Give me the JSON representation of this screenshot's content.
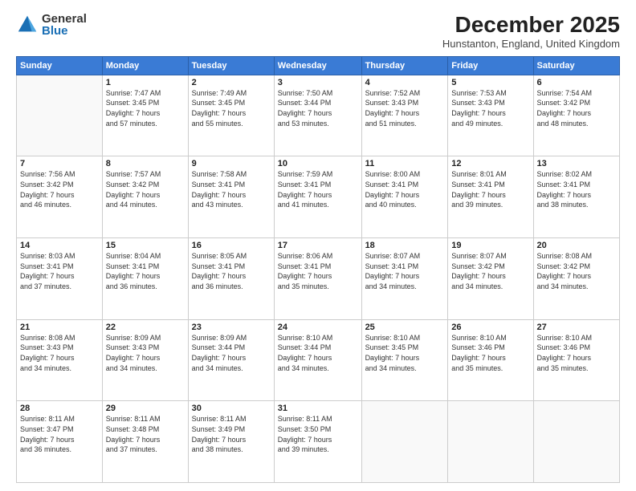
{
  "logo": {
    "general": "General",
    "blue": "Blue"
  },
  "title": "December 2025",
  "location": "Hunstanton, England, United Kingdom",
  "days_header": [
    "Sunday",
    "Monday",
    "Tuesday",
    "Wednesday",
    "Thursday",
    "Friday",
    "Saturday"
  ],
  "weeks": [
    [
      {
        "day": "",
        "info": ""
      },
      {
        "day": "1",
        "info": "Sunrise: 7:47 AM\nSunset: 3:45 PM\nDaylight: 7 hours\nand 57 minutes."
      },
      {
        "day": "2",
        "info": "Sunrise: 7:49 AM\nSunset: 3:45 PM\nDaylight: 7 hours\nand 55 minutes."
      },
      {
        "day": "3",
        "info": "Sunrise: 7:50 AM\nSunset: 3:44 PM\nDaylight: 7 hours\nand 53 minutes."
      },
      {
        "day": "4",
        "info": "Sunrise: 7:52 AM\nSunset: 3:43 PM\nDaylight: 7 hours\nand 51 minutes."
      },
      {
        "day": "5",
        "info": "Sunrise: 7:53 AM\nSunset: 3:43 PM\nDaylight: 7 hours\nand 49 minutes."
      },
      {
        "day": "6",
        "info": "Sunrise: 7:54 AM\nSunset: 3:42 PM\nDaylight: 7 hours\nand 48 minutes."
      }
    ],
    [
      {
        "day": "7",
        "info": "Sunrise: 7:56 AM\nSunset: 3:42 PM\nDaylight: 7 hours\nand 46 minutes."
      },
      {
        "day": "8",
        "info": "Sunrise: 7:57 AM\nSunset: 3:42 PM\nDaylight: 7 hours\nand 44 minutes."
      },
      {
        "day": "9",
        "info": "Sunrise: 7:58 AM\nSunset: 3:41 PM\nDaylight: 7 hours\nand 43 minutes."
      },
      {
        "day": "10",
        "info": "Sunrise: 7:59 AM\nSunset: 3:41 PM\nDaylight: 7 hours\nand 41 minutes."
      },
      {
        "day": "11",
        "info": "Sunrise: 8:00 AM\nSunset: 3:41 PM\nDaylight: 7 hours\nand 40 minutes."
      },
      {
        "day": "12",
        "info": "Sunrise: 8:01 AM\nSunset: 3:41 PM\nDaylight: 7 hours\nand 39 minutes."
      },
      {
        "day": "13",
        "info": "Sunrise: 8:02 AM\nSunset: 3:41 PM\nDaylight: 7 hours\nand 38 minutes."
      }
    ],
    [
      {
        "day": "14",
        "info": "Sunrise: 8:03 AM\nSunset: 3:41 PM\nDaylight: 7 hours\nand 37 minutes."
      },
      {
        "day": "15",
        "info": "Sunrise: 8:04 AM\nSunset: 3:41 PM\nDaylight: 7 hours\nand 36 minutes."
      },
      {
        "day": "16",
        "info": "Sunrise: 8:05 AM\nSunset: 3:41 PM\nDaylight: 7 hours\nand 36 minutes."
      },
      {
        "day": "17",
        "info": "Sunrise: 8:06 AM\nSunset: 3:41 PM\nDaylight: 7 hours\nand 35 minutes."
      },
      {
        "day": "18",
        "info": "Sunrise: 8:07 AM\nSunset: 3:41 PM\nDaylight: 7 hours\nand 34 minutes."
      },
      {
        "day": "19",
        "info": "Sunrise: 8:07 AM\nSunset: 3:42 PM\nDaylight: 7 hours\nand 34 minutes."
      },
      {
        "day": "20",
        "info": "Sunrise: 8:08 AM\nSunset: 3:42 PM\nDaylight: 7 hours\nand 34 minutes."
      }
    ],
    [
      {
        "day": "21",
        "info": "Sunrise: 8:08 AM\nSunset: 3:43 PM\nDaylight: 7 hours\nand 34 minutes."
      },
      {
        "day": "22",
        "info": "Sunrise: 8:09 AM\nSunset: 3:43 PM\nDaylight: 7 hours\nand 34 minutes."
      },
      {
        "day": "23",
        "info": "Sunrise: 8:09 AM\nSunset: 3:44 PM\nDaylight: 7 hours\nand 34 minutes."
      },
      {
        "day": "24",
        "info": "Sunrise: 8:10 AM\nSunset: 3:44 PM\nDaylight: 7 hours\nand 34 minutes."
      },
      {
        "day": "25",
        "info": "Sunrise: 8:10 AM\nSunset: 3:45 PM\nDaylight: 7 hours\nand 34 minutes."
      },
      {
        "day": "26",
        "info": "Sunrise: 8:10 AM\nSunset: 3:46 PM\nDaylight: 7 hours\nand 35 minutes."
      },
      {
        "day": "27",
        "info": "Sunrise: 8:10 AM\nSunset: 3:46 PM\nDaylight: 7 hours\nand 35 minutes."
      }
    ],
    [
      {
        "day": "28",
        "info": "Sunrise: 8:11 AM\nSunset: 3:47 PM\nDaylight: 7 hours\nand 36 minutes."
      },
      {
        "day": "29",
        "info": "Sunrise: 8:11 AM\nSunset: 3:48 PM\nDaylight: 7 hours\nand 37 minutes."
      },
      {
        "day": "30",
        "info": "Sunrise: 8:11 AM\nSunset: 3:49 PM\nDaylight: 7 hours\nand 38 minutes."
      },
      {
        "day": "31",
        "info": "Sunrise: 8:11 AM\nSunset: 3:50 PM\nDaylight: 7 hours\nand 39 minutes."
      },
      {
        "day": "",
        "info": ""
      },
      {
        "day": "",
        "info": ""
      },
      {
        "day": "",
        "info": ""
      }
    ]
  ]
}
